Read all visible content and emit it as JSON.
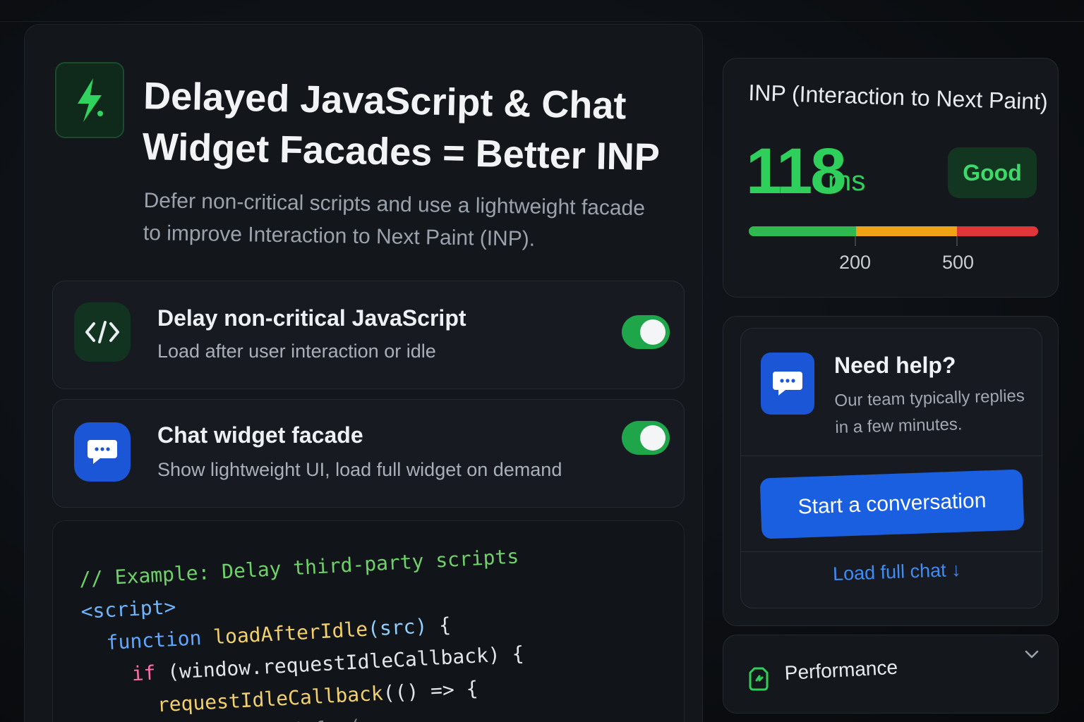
{
  "hero": {
    "title": "Delayed JavaScript & Chat Widget Facades = Better INP",
    "subtitle": "Defer non-critical scripts and use a lightweight facade to improve Interaction to Next Paint (INP).",
    "icon": "bolt-icon"
  },
  "options": [
    {
      "title": "Delay non-critical JavaScript",
      "subtitle": "Load after user interaction or idle",
      "icon": "code-icon",
      "enabled": true
    },
    {
      "title": "Chat widget facade",
      "subtitle": "Show lightweight UI, load full widget on demand",
      "icon": "chat-icon",
      "enabled": true
    }
  ],
  "code": {
    "line1": "// Example: Delay third-party scripts",
    "line2": "<script>",
    "line3_kw": "function",
    "line3_fn": "loadAfterIdle",
    "line3_param": "(src)",
    "line3_rest": " {",
    "line4_kw": "if",
    "line4_rest": " (window.requestIdleCallback) {",
    "line5_fn": "requestIdleCallback",
    "line5_rest": "(() => {",
    "line6": "...ifiedefer("
  },
  "inp": {
    "title": "INP (Interaction to Next Paint)",
    "value": "118",
    "unit": "ms",
    "rating": "Good",
    "thresholds": [
      "200",
      "500"
    ],
    "colors": {
      "good": "#2fb84f",
      "needs_improvement": "#f0a215",
      "poor": "#e0363a"
    }
  },
  "help": {
    "title": "Need help?",
    "subtitle": "Our team typically replies in a few minutes.",
    "button": "Start a conversation",
    "link": "Load full chat ↓",
    "icon": "chat-icon"
  },
  "performance": {
    "label": "Performance",
    "icon": "gauge-icon",
    "chevron": "chevron-down-icon"
  }
}
